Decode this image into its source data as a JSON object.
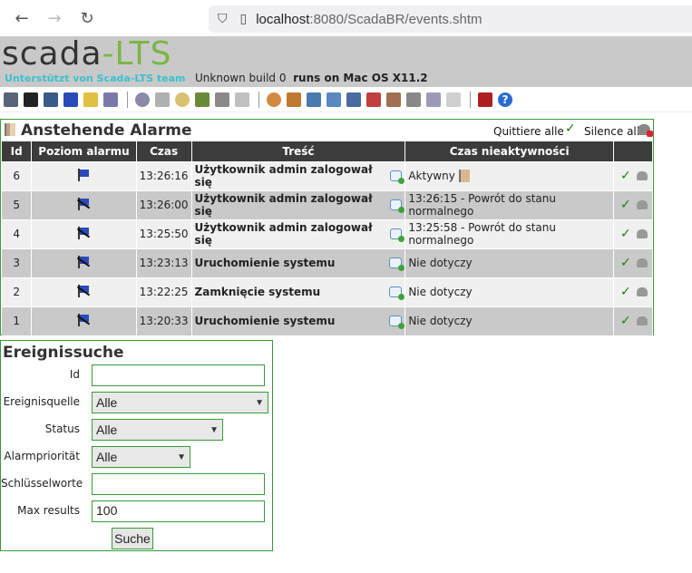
{
  "browser": {
    "url_host": "localhost",
    "url_path": ":8080/ScadaBR/events.shtm"
  },
  "header": {
    "logo_main": "scada",
    "logo_accent": "-LTS",
    "tagline": "Unterstützt von Scada-LTS team",
    "build_text": "Unknown build 0",
    "runs_on": "runs on Mac OS X11.2"
  },
  "alarms": {
    "title": "Anstehende Alarme",
    "ack_all": "Quittiere alle",
    "silence_all": "Silence all",
    "columns": [
      "Id",
      "Poziom alarmu",
      "Czas",
      "Treść",
      "Czas nieaktywności"
    ],
    "rows": [
      {
        "id": "6",
        "level_icon": "flag-active-icon",
        "time": "13:26:16",
        "message": "Użytkownik admin zalogował się",
        "return": "Aktywny"
      },
      {
        "id": "5",
        "level_icon": "flag-inactive-icon",
        "time": "13:26:00",
        "message": "Użytkownik admin zalogował się",
        "return": "13:26:15 - Powrót do stanu normalnego"
      },
      {
        "id": "4",
        "level_icon": "flag-inactive-icon",
        "time": "13:25:50",
        "message": "Użytkownik admin zalogował się",
        "return": "13:25:58 - Powrót do stanu normalnego"
      },
      {
        "id": "3",
        "level_icon": "flag-inactive-icon",
        "time": "13:23:13",
        "message": "Uruchomienie systemu",
        "return": "Nie dotyczy"
      },
      {
        "id": "2",
        "level_icon": "flag-inactive-icon",
        "time": "13:22:25",
        "message": "Zamknięcie systemu",
        "return": "Nie dotyczy"
      },
      {
        "id": "1",
        "level_icon": "flag-inactive-icon",
        "time": "13:20:33",
        "message": "Uruchomienie systemu",
        "return": "Nie dotyczy"
      }
    ]
  },
  "search": {
    "title": "Ereignissuche",
    "labels": {
      "id": "Id",
      "source": "Ereignisquelle",
      "status": "Status",
      "priority": "Alarmpriorität",
      "keywords": "Schlüsselworte",
      "max_results": "Max results"
    },
    "values": {
      "id": "",
      "source": "Alle",
      "status": "Alle",
      "priority": "Alle",
      "keywords": "",
      "max_results": "100"
    },
    "button": "Suche"
  },
  "colors": {
    "panel_border": "#3a9a3a",
    "header_bg": "#c9c9c9",
    "table_header_bg": "#3c3c3c",
    "logo_accent": "#7ab648",
    "tagline": "#3cc0cf"
  },
  "toolbar_icons": [
    "watchlist-icon",
    "graphic-views-icon",
    "event-report-icon",
    "alarms-icon",
    "reports-icon",
    "data-sources-icon",
    "datastore-icon",
    "scheduled-events-icon",
    "compound-events-icon",
    "point-links-icon",
    "scripts-icon",
    "users-icon",
    "user-profiles-icon",
    "point-hierarchy-icon",
    "mailing-lists-icon",
    "publishers-icon",
    "maintenance-icon",
    "system-settings-icon",
    "emport-icon",
    "sql-icon",
    "logout-icon",
    "help-icon"
  ]
}
